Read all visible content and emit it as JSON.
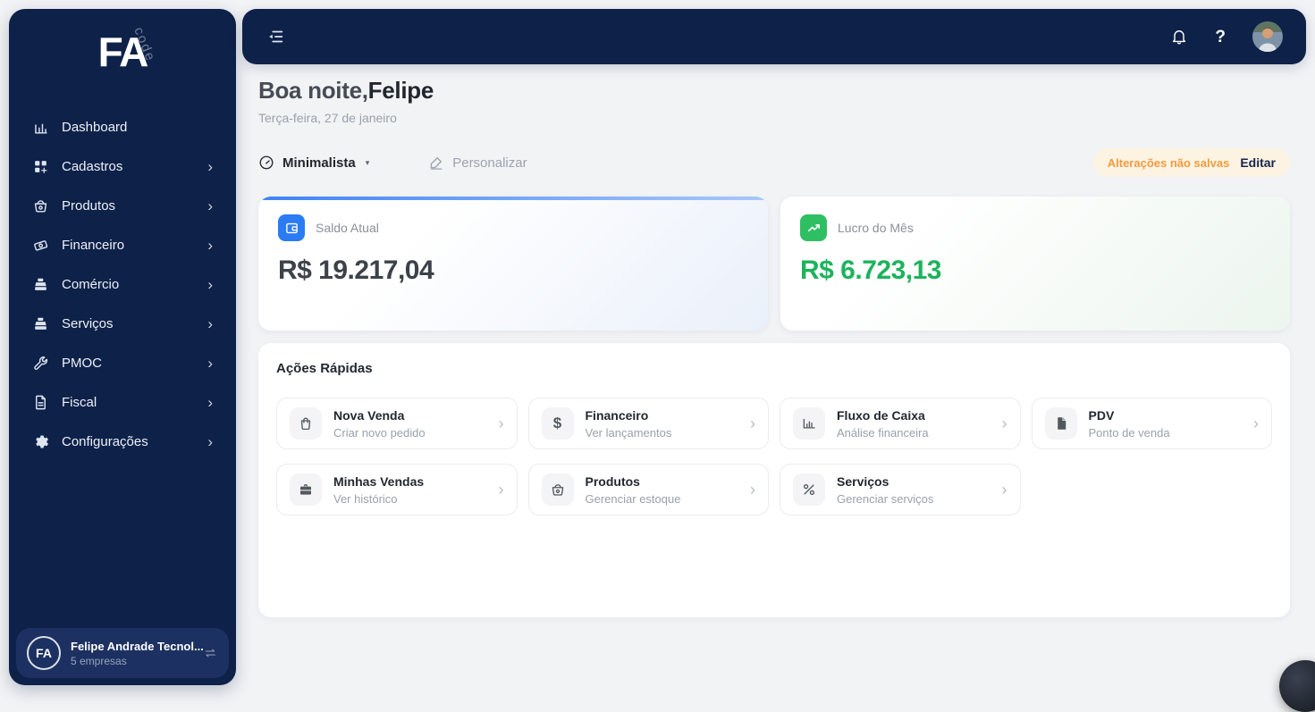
{
  "app": {
    "logo_main": "FA",
    "logo_sub": "code"
  },
  "colors": {
    "sidebar_navy": "#0d2149",
    "account_card": "#1c3161",
    "accent_blue": "#2b7bf3",
    "accent_green": "#2fbf63",
    "value_green": "#1db35c",
    "warning_bg": "#fdf3e2",
    "warning_text": "#f09c3d"
  },
  "sidebar": {
    "items": [
      {
        "label": "Dashboard",
        "icon": "bar-chart-icon",
        "has_submenu": false
      },
      {
        "label": "Cadastros",
        "icon": "grid-plus-icon",
        "has_submenu": true
      },
      {
        "label": "Produtos",
        "icon": "basket-icon",
        "has_submenu": true
      },
      {
        "label": "Financeiro",
        "icon": "banknote-icon",
        "has_submenu": true
      },
      {
        "label": "Comércio",
        "icon": "cash-register-icon",
        "has_submenu": true
      },
      {
        "label": "Serviços",
        "icon": "cash-register-icon",
        "has_submenu": true
      },
      {
        "label": "PMOC",
        "icon": "wrench-icon",
        "has_submenu": true
      },
      {
        "label": "Fiscal",
        "icon": "document-icon",
        "has_submenu": true
      },
      {
        "label": "Configurações",
        "icon": "gear-icon",
        "has_submenu": true
      }
    ],
    "account": {
      "initials": "FA",
      "name": "Felipe Andrade Tecnol...",
      "subtitle": "5 empresas",
      "icon": "swap-icon"
    }
  },
  "topbar": {
    "collapse_icon": "collapse-sidebar-icon",
    "bell_icon": "bell-icon",
    "help_label": "?",
    "avatar": "user-photo"
  },
  "greeting": {
    "salutation": "Boa noite,",
    "name": "Felipe",
    "date": "Terça-feira, 27 de janeiro"
  },
  "view_tabs": {
    "active": {
      "label": "Minimalista",
      "icon": "gauge-icon",
      "caret": "▾"
    },
    "secondary": {
      "label": "Personalizar",
      "icon": "pen-icon"
    }
  },
  "unsaved": {
    "message": "Alterações não salvas",
    "action": "Editar"
  },
  "summary_cards": [
    {
      "label": "Saldo Atual",
      "value": "R$ 19.217,04",
      "icon": "wallet-icon",
      "accent": "#2b7bf3"
    },
    {
      "label": "Lucro do Mês",
      "value": "R$ 6.723,13",
      "icon": "trending-up-icon",
      "accent": "#2fbf63"
    }
  ],
  "quick_actions": {
    "title": "Ações Rápidas",
    "items": [
      {
        "title": "Nova Venda",
        "subtitle": "Criar novo pedido",
        "icon": "shopping-bag-icon"
      },
      {
        "title": "Financeiro",
        "subtitle": "Ver lançamentos",
        "icon": "dollar-icon"
      },
      {
        "title": "Fluxo de Caixa",
        "subtitle": "Análise financeira",
        "icon": "chart-icon"
      },
      {
        "title": "PDV",
        "subtitle": "Ponto de venda",
        "icon": "receipt-icon"
      },
      {
        "title": "Minhas Vendas",
        "subtitle": "Ver histórico",
        "icon": "briefcase-icon"
      },
      {
        "title": "Produtos",
        "subtitle": "Gerenciar estoque",
        "icon": "basket-icon"
      },
      {
        "title": "Serviços",
        "subtitle": "Gerenciar serviços",
        "icon": "tools-icon"
      }
    ]
  }
}
